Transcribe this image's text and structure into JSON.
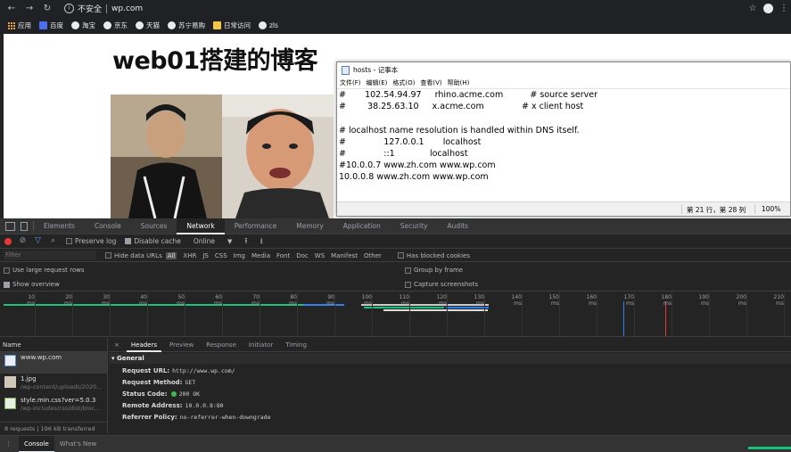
{
  "browser": {
    "security_label": "不安全",
    "url": "wp.com"
  },
  "bookmarks": [
    {
      "label": "应用",
      "icon": "apps-icon"
    },
    {
      "label": "百度",
      "icon": "baidu-icon"
    },
    {
      "label": "淘宝",
      "icon": "globe-icon"
    },
    {
      "label": "京东",
      "icon": "globe-icon"
    },
    {
      "label": "天猫",
      "icon": "globe-icon"
    },
    {
      "label": "苏宁易购",
      "icon": "globe-icon"
    },
    {
      "label": "日常访问",
      "icon": "folder-icon"
    },
    {
      "label": "zls",
      "icon": "globe-icon"
    }
  ],
  "page": {
    "title": "web01搭建的博客"
  },
  "notepad": {
    "title": "hosts - 记事本",
    "menu": [
      "文件(F)",
      "编辑(E)",
      "格式(O)",
      "查看(V)",
      "帮助(H)"
    ],
    "lines": [
      "#       102.54.94.97     rhino.acme.com          # source server",
      "#        38.25.63.10     x.acme.com              # x client host",
      "",
      "# localhost name resolution is handled within DNS itself.",
      "#              127.0.0.1       localhost",
      "#              ::1             localhost",
      "#10.0.0.7 www.zh.com www.wp.com",
      "10.0.0.8 www.zh.com www.wp.com"
    ],
    "status_position": "第 21 行，第 28 列",
    "status_zoom": "100%"
  },
  "devtools": {
    "tabs": [
      "Elements",
      "Console",
      "Sources",
      "Network",
      "Performance",
      "Memory",
      "Application",
      "Security",
      "Audits"
    ],
    "active_tab": "Network",
    "toolbar": {
      "preserve_log": "Preserve log",
      "disable_cache": "Disable cache",
      "throttle": "Online"
    },
    "filter": {
      "placeholder": "Filter",
      "hide_data_urls": "Hide data URLs",
      "all_label": "All",
      "types": [
        "XHR",
        "JS",
        "CSS",
        "Img",
        "Media",
        "Font",
        "Doc",
        "WS",
        "Manifest",
        "Other"
      ],
      "has_blocked": "Has blocked cookies"
    },
    "settings": {
      "large_rows": "Use large request rows",
      "overview": "Show overview",
      "group_frame": "Group by frame",
      "screenshots": "Capture screenshots"
    },
    "timeline_ticks": [
      "10 ms",
      "20 ms",
      "30 ms",
      "40 ms",
      "50 ms",
      "60 ms",
      "70 ms",
      "80 ms",
      "90 ms",
      "100 ms",
      "110 ms",
      "120 ms",
      "130 ms",
      "140 ms",
      "150 ms",
      "160 ms",
      "170 ms",
      "180 ms",
      "190 ms",
      "200 ms",
      "210 ms"
    ],
    "list_header": "Name",
    "requests": [
      {
        "name": "www.wp.com",
        "path": "",
        "type": "html"
      },
      {
        "name": "1.jpg",
        "path": "/wp-content/uploads/2020...",
        "type": "img"
      },
      {
        "name": "style.min.css?ver=5.0.3",
        "path": "/wp-includes/css/dist/bloc...",
        "type": "css"
      }
    ],
    "summary": "8 requests | 196 kB transferred",
    "detail_tabs": [
      "Headers",
      "Preview",
      "Response",
      "Initiator",
      "Timing"
    ],
    "active_detail_tab": "Headers",
    "general_label": "General",
    "general": [
      {
        "key": "Request URL:",
        "value": "http://www.wp.com/"
      },
      {
        "key": "Request Method:",
        "value": "GET"
      },
      {
        "key": "Status Code:",
        "value": "200 OK"
      },
      {
        "key": "Remote Address:",
        "value": "10.0.0.8:80"
      },
      {
        "key": "Referrer Policy:",
        "value": "no-referrer-when-downgrade"
      }
    ],
    "drawer_tabs": [
      "Console",
      "What's New"
    ],
    "active_drawer_tab": "Console"
  }
}
